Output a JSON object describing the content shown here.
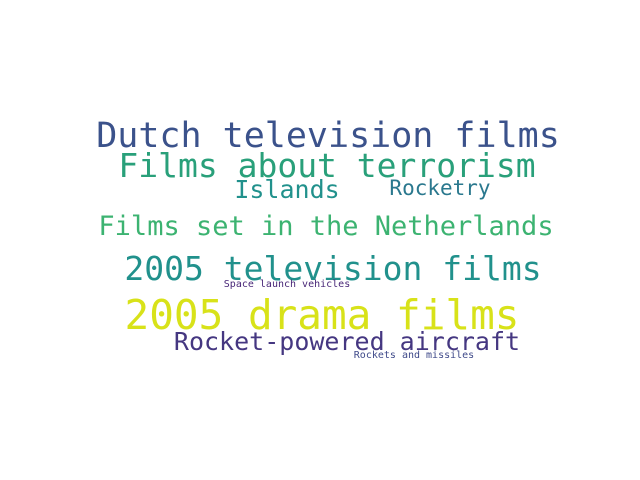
{
  "words": [
    {
      "text": "Dutch television films",
      "color": "#3b528b"
    },
    {
      "text": "Films about terrorism",
      "color": "#29a07a"
    },
    {
      "text": "Islands",
      "color": "#21918c"
    },
    {
      "text": "Rocketry",
      "color": "#2a788e"
    },
    {
      "text": "Films set in the Netherlands",
      "color": "#3cb371"
    },
    {
      "text": "2005 television films",
      "color": "#21918c"
    },
    {
      "text": "Space launch vehicles",
      "color": "#482677"
    },
    {
      "text": "2005 drama films",
      "color": "#d8e219"
    },
    {
      "text": "Rocket-powered aircraft",
      "color": "#453781"
    },
    {
      "text": "Rockets and missiles",
      "color": "#3e4989"
    }
  ]
}
